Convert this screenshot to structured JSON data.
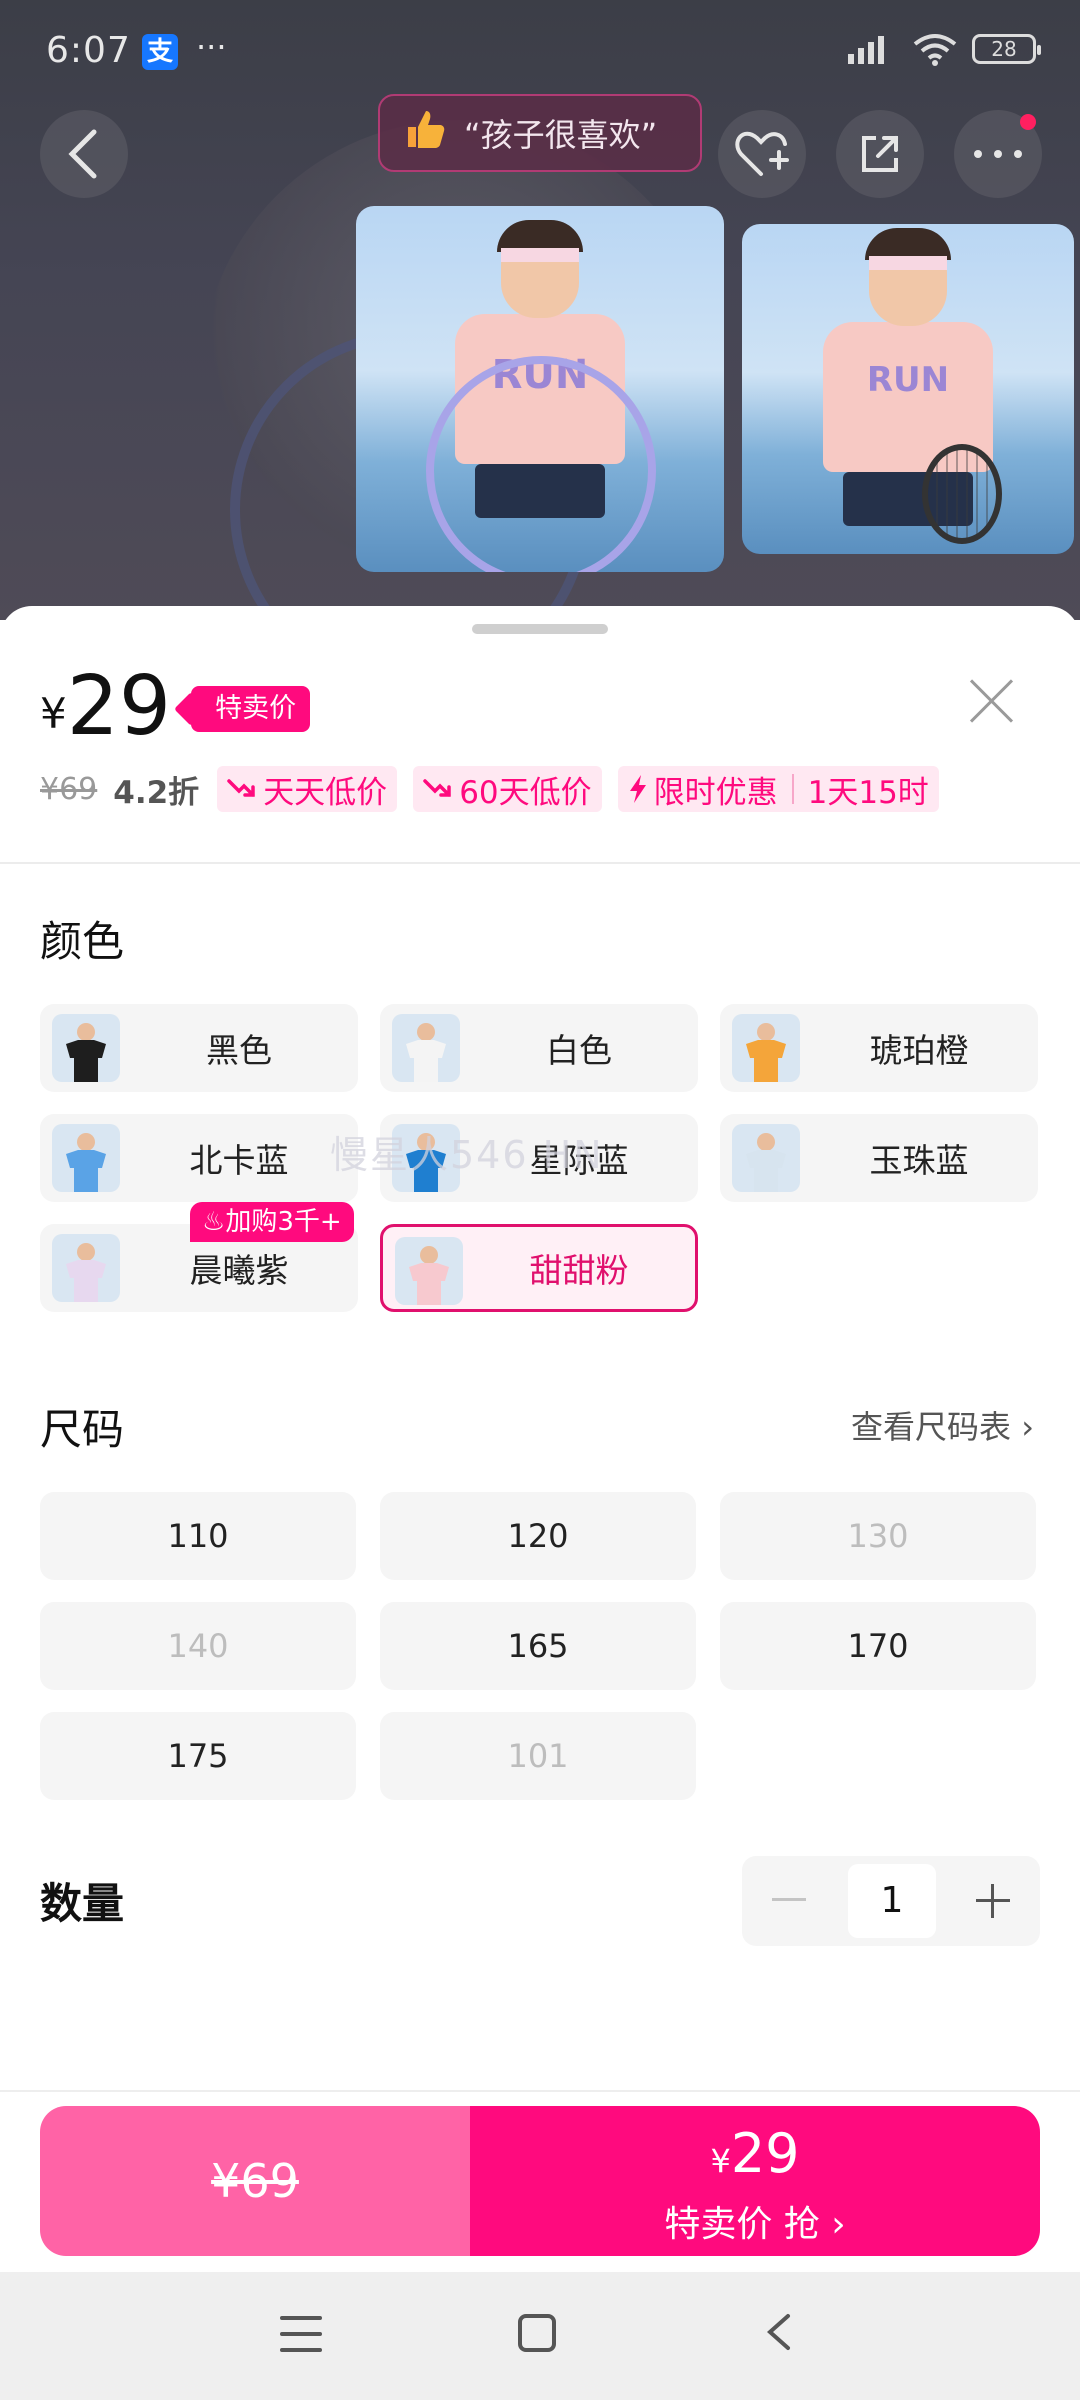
{
  "status_bar": {
    "time": "6:07",
    "alipay": "支",
    "dots": "···",
    "battery": "28"
  },
  "header": {
    "praise_text": "“孩子很喜欢”"
  },
  "product_images": [
    {
      "shirt_text": "RUN"
    },
    {
      "shirt_text": "RUN"
    }
  ],
  "price": {
    "currency": "¥",
    "current": "29",
    "special_tag": "特卖价",
    "original": "¥69",
    "discount": "4.2折",
    "chips": [
      "天天低价",
      "60天低价",
      "限时优惠",
      "1天15时"
    ]
  },
  "color_section": {
    "title": "颜色",
    "options": [
      {
        "label": "黑色",
        "shirt_color": "#1e1e1e"
      },
      {
        "label": "白色",
        "shirt_color": "#f4f4f4"
      },
      {
        "label": "琥珀橙",
        "shirt_color": "#f4a53a"
      },
      {
        "label": "北卡蓝",
        "shirt_color": "#5aa3e6"
      },
      {
        "label": "星际蓝",
        "shirt_color": "#1f7fd0"
      },
      {
        "label": "玉珠蓝",
        "shirt_color": "#d7e4ef"
      },
      {
        "label": "晨曦紫",
        "shirt_color": "#e7d8ef",
        "badge": "加购3千+"
      },
      {
        "label": "甜甜粉",
        "shirt_color": "#f7c9cf",
        "selected": true
      }
    ]
  },
  "size_section": {
    "title": "尺码",
    "chart_link": "查看尺码表 ›",
    "sizes": [
      {
        "label": "110",
        "available": true
      },
      {
        "label": "120",
        "available": true
      },
      {
        "label": "130",
        "available": false
      },
      {
        "label": "140",
        "available": false
      },
      {
        "label": "165",
        "available": true
      },
      {
        "label": "170",
        "available": true
      },
      {
        "label": "175",
        "available": true
      },
      {
        "label": "101",
        "available": false
      }
    ]
  },
  "quantity": {
    "title": "数量",
    "value": "1"
  },
  "watermark": "慢星人546 HN",
  "cta": {
    "original_price": "¥69",
    "price_currency": "¥",
    "price": "29",
    "label": "特卖价 抢 ›"
  },
  "colors": {
    "accent": "#ff0a7e",
    "accent_light": "#ff63a6",
    "selected_border": "#e0106d"
  }
}
